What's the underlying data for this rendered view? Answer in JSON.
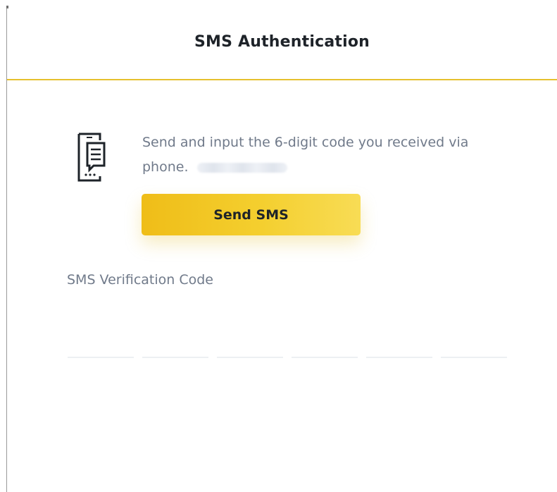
{
  "dialog": {
    "title": "SMS Authentication",
    "accent_color": "#e6c02e"
  },
  "instructions": {
    "icon": "phone-message-icon",
    "text": "Send and input the 6-digit code you received via phone.",
    "phone_number": "••••••••••"
  },
  "send_button": {
    "label": "Send SMS",
    "color": "#f0c21f"
  },
  "verification": {
    "label": "SMS Verification Code",
    "digits": [
      "",
      "",
      "",
      "",
      "",
      ""
    ]
  }
}
